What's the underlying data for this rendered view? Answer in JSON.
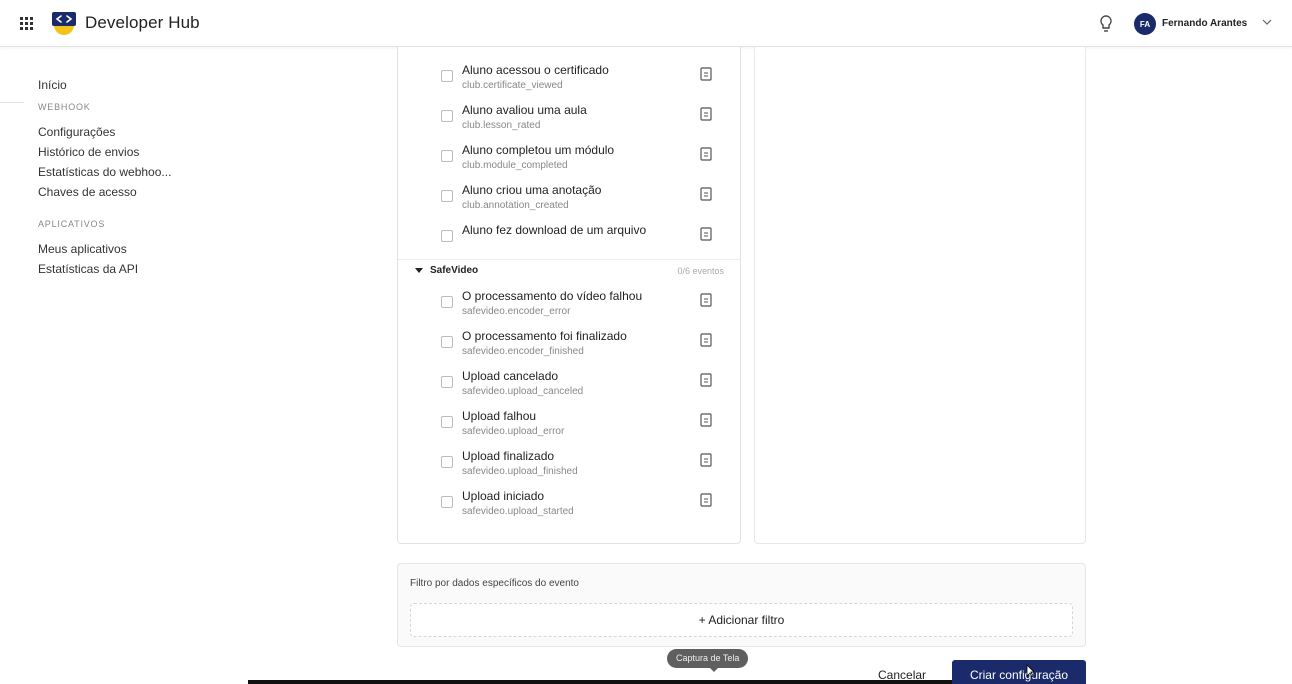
{
  "header": {
    "brand": "Developer Hub",
    "user_initials": "FA",
    "user_name": "Fernando Arantes"
  },
  "sidebar": {
    "home": "Início",
    "webhook_section": "WEBHOOK",
    "webhook_items": [
      "Configurações",
      "Histórico de envios",
      "Estatísticas do webhoo...",
      "Chaves de acesso"
    ],
    "apps_section": "APLICATIVOS",
    "apps_items": [
      "Meus aplicativos",
      "Estatísticas da API"
    ]
  },
  "events": {
    "club_events": [
      {
        "label": "Aluno acessou o certificado",
        "code": "club.certificate_viewed"
      },
      {
        "label": "Aluno avaliou uma aula",
        "code": "club.lesson_rated"
      },
      {
        "label": "Aluno completou um módulo",
        "code": "club.module_completed"
      },
      {
        "label": "Aluno criou uma anotação",
        "code": "club.annotation_created"
      },
      {
        "label": "Aluno fez download de um arquivo",
        "code": ""
      }
    ],
    "group": {
      "name": "SafeVideo",
      "count": "0/6 eventos"
    },
    "safevideo_events": [
      {
        "label": "O processamento do vídeo falhou",
        "code": "safevideo.encoder_error"
      },
      {
        "label": "O processamento foi finalizado",
        "code": "safevideo.encoder_finished"
      },
      {
        "label": "Upload cancelado",
        "code": "safevideo.upload_canceled"
      },
      {
        "label": "Upload falhou",
        "code": "safevideo.upload_error"
      },
      {
        "label": "Upload finalizado",
        "code": "safevideo.upload_finished"
      },
      {
        "label": "Upload iniciado",
        "code": "safevideo.upload_started"
      }
    ]
  },
  "filter": {
    "title": "Filtro por dados específicos do evento",
    "add_label": "+ Adicionar filtro"
  },
  "footer": {
    "tooltip": "Captura de Tela",
    "cancel_label": "Cancelar",
    "create_label": "Criar configuração"
  },
  "colors": {
    "primary": "#1b2a6b",
    "logo_yellow": "#f2c417"
  }
}
